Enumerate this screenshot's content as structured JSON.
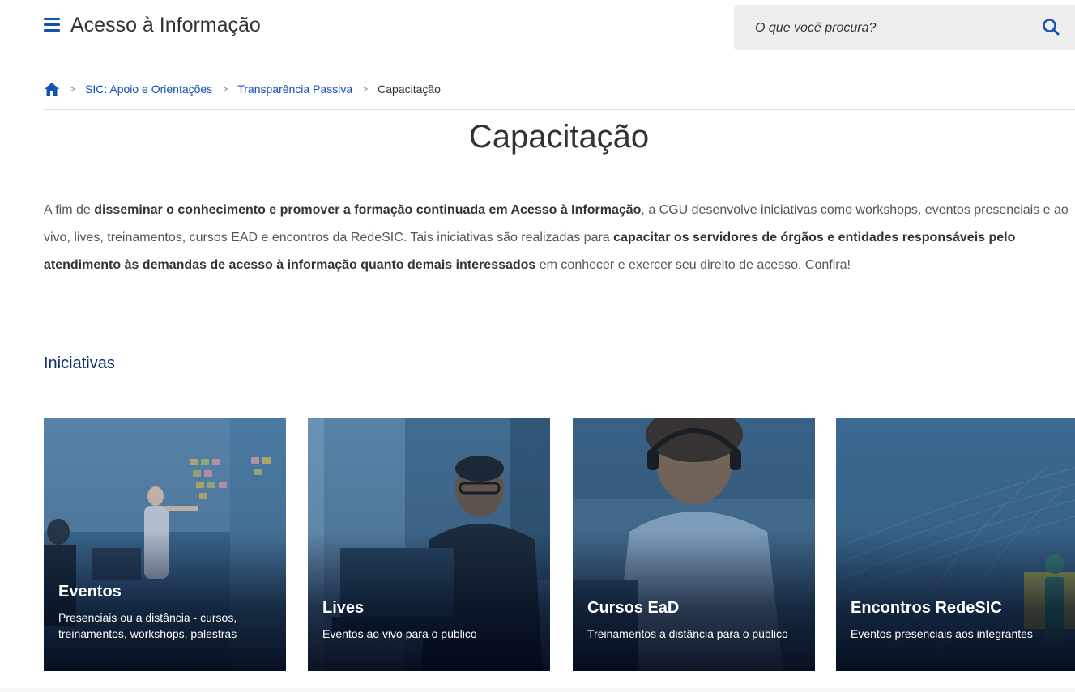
{
  "header": {
    "site_title": "Acesso à Informação",
    "search_placeholder": "O que você procura?",
    "menu_icon": "hamburger-menu-icon",
    "search_icon": "search-icon",
    "brand_color": "#1351b4"
  },
  "breadcrumb": {
    "home_icon": "home-icon",
    "items": [
      "SIC: Apoio e Orientações",
      "Transparência Passiva"
    ],
    "current": "Capacitação"
  },
  "main": {
    "title": "Capacitação",
    "intro": {
      "p1": "A fim de ",
      "b1": "disseminar o conhecimento e promover a formação continuada em Acesso à Informação",
      "p2": ", a CGU desenvolve iniciativas como workshops, eventos presenciais e ao vivo, lives, treinamentos, cursos EAD e encontros da RedeSIC. Tais iniciativas são realizadas para ",
      "b2": "capacitar os servidores de órgãos e entidades responsáveis pelo atendimento às demandas de acesso à informação quanto demais interessados",
      "p3": " em conhecer e exercer seu direito de acesso. Confira!"
    },
    "section_title": "Iniciativas",
    "cards": [
      {
        "title": "Eventos",
        "description": "Presenciais ou a distância - cursos, treinamentos, workshops, palestras"
      },
      {
        "title": "Lives",
        "description": "Eventos ao vivo para o público"
      },
      {
        "title": "Cursos EaD",
        "description": "Treinamentos a distância para o público"
      },
      {
        "title": "Encontros RedeSIC",
        "description": "Eventos presenciais aos integrantes"
      }
    ]
  }
}
